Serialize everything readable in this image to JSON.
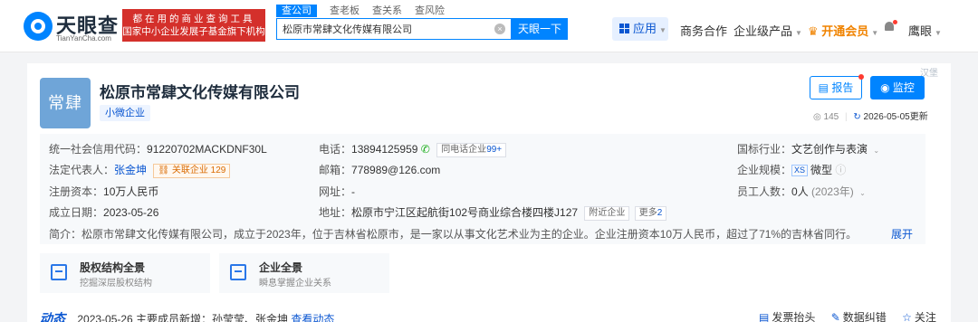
{
  "header": {
    "logo_name": "天眼查",
    "logo_url": "TianYanCha.com",
    "slogan_line1": "都在用的商业查询工具",
    "slogan_line2": "国家中小企业发展子基金旗下机构",
    "search_tabs": [
      "查公司",
      "查老板",
      "查关系",
      "查风险"
    ],
    "search_value": "松原市常肆文化传媒有限公司",
    "search_button": "天眼一下",
    "nav": {
      "apps": "应用",
      "business": "商务合作",
      "enterprise": "企业级产品",
      "vip": "开通会员",
      "user": "鹰眼"
    }
  },
  "company": {
    "logo_text": "常肆",
    "name": "松原市常肆文化传媒有限公司",
    "scale_tag": "小微企业",
    "report_button": "报告",
    "monitor_button": "监控",
    "views": "145",
    "updated": "2026-05-05更新",
    "info": {
      "credit_code_label": "统一社会信用代码：",
      "credit_code": "91220702MACKDNF30L",
      "legal_rep_label": "法定代表人：",
      "legal_rep": "张金坤",
      "related_label": "关联企业",
      "related_count": "129",
      "capital_label": "注册资本：",
      "capital": "10万人民币",
      "founded_label": "成立日期：",
      "founded": "2023-05-26",
      "phone_label": "电话：",
      "phone": "13894125959",
      "same_phone_label": "同电话企业",
      "same_phone_count": "99+",
      "email_label": "邮箱：",
      "email": "778989@126.com",
      "website_label": "网址：",
      "website": "-",
      "address_label": "地址：",
      "address": "松原市宁江区起航街102号商业综合楼四楼J127",
      "nearby_label": "附近企业",
      "more_label": "更多",
      "more_count": "2",
      "industry_label": "国标行业：",
      "industry": "文艺创作与表演",
      "scale_label": "企业规模：",
      "scale_badge": "XS",
      "scale": "微型",
      "staff_label": "员工人数：",
      "staff": "0人",
      "staff_year": "(2023年)",
      "intro_label": "简介：",
      "intro": "松原市常肆文化传媒有限公司，成立于2023年，位于吉林省松原市，是一家以从事文化艺术业为主的企业。企业注册资本10万人民币，超过了71%的吉林省同行。",
      "expand": "展开"
    },
    "features": [
      {
        "title": "股权结构全景",
        "sub": "挖掘深层股权结构"
      },
      {
        "title": "企业全景",
        "sub": "瞬息掌握企业关系"
      }
    ],
    "dynamic": {
      "badge": "动态",
      "text": "2023-05-26 主要成员新增：孙莹莹、张金坤",
      "link": "查看动态"
    },
    "actions": [
      "发票抬头",
      "数据纠错",
      "关注"
    ],
    "corner": "汉堡"
  }
}
